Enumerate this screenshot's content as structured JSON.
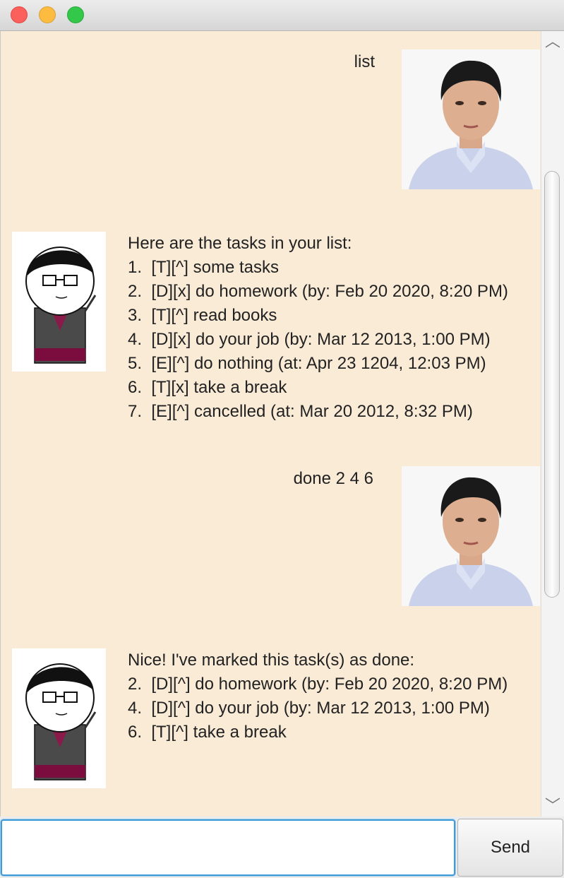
{
  "window": {
    "controls": [
      "close",
      "minimize",
      "maximize"
    ]
  },
  "conversation": [
    {
      "from": "user",
      "text": "list"
    },
    {
      "from": "bot",
      "lines": [
        "Here are the tasks in your list:",
        "1.  [T][^] some tasks",
        "2.  [D][x] do homework (by: Feb 20 2020, 8:20 PM)",
        "3.  [T][^] read books",
        "4.  [D][x] do your job (by: Mar 12 2013, 1:00 PM)",
        "5.  [E][^] do nothing (at: Apr 23 1204, 12:03 PM)",
        "6.  [T][x] take a break",
        "7.  [E][^] cancelled (at: Mar 20 2012, 8:32 PM)"
      ]
    },
    {
      "from": "user",
      "text": "done 2 4 6"
    },
    {
      "from": "bot",
      "lines": [
        "Nice! I've marked this task(s) as done:",
        "2.  [D][^] do homework (by: Feb 20 2020, 8:20 PM)",
        "4.  [D][^] do your job (by: Mar 12 2013, 1:00 PM)",
        "6.  [T][^] take a break"
      ]
    }
  ],
  "input": {
    "value": "",
    "placeholder": ""
  },
  "send_button": {
    "label": "Send"
  },
  "colors": {
    "chat_bg": "#faebd7",
    "input_focus": "#3d9bd6"
  },
  "icons": [
    "user-avatar",
    "bot-avatar",
    "scroll-up-arrow",
    "scroll-down-arrow"
  ]
}
